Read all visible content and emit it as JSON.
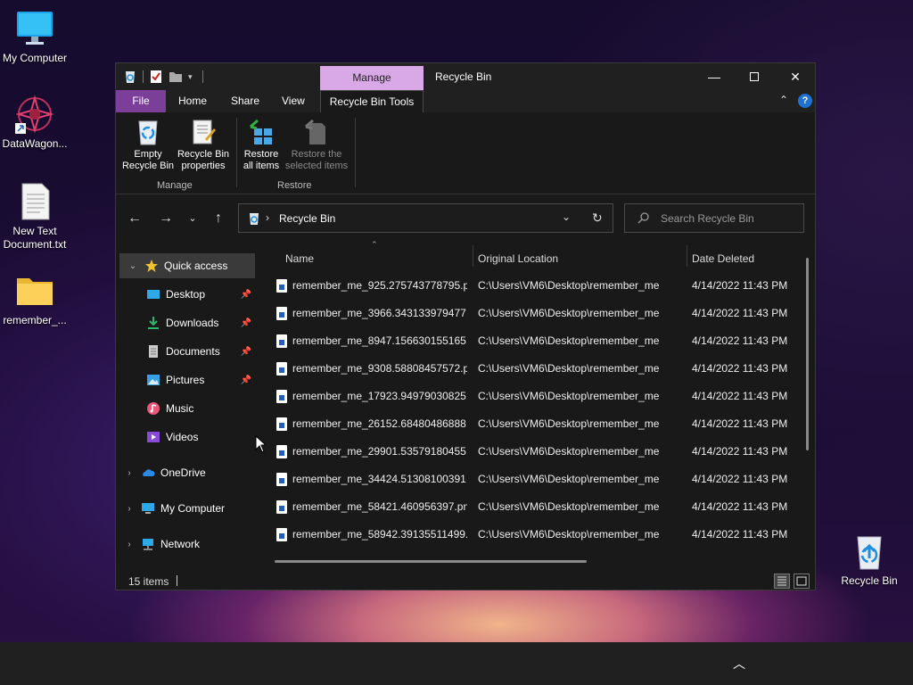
{
  "desktop": {
    "icons": [
      {
        "label": "My Computer"
      },
      {
        "label": "DataWagon..."
      },
      {
        "label": "New Text Document.txt"
      },
      {
        "label": "remember_..."
      },
      {
        "label": "Recycle Bin"
      }
    ]
  },
  "window": {
    "title": "Recycle Bin",
    "context_tab": "Manage",
    "tabs": [
      "File",
      "Home",
      "Share",
      "View",
      "Recycle Bin Tools"
    ],
    "ribbon": {
      "manage_group_label": "Manage",
      "restore_group_label": "Restore",
      "empty_bin": "Empty Recycle Bin",
      "properties": "Recycle Bin properties",
      "restore_all": "Restore all items",
      "restore_selected": "Restore the selected items"
    },
    "address": {
      "path": "Recycle Bin",
      "search_placeholder": "Search Recycle Bin"
    },
    "nav": {
      "quick_access": "Quick access",
      "desktop": "Desktop",
      "downloads": "Downloads",
      "documents": "Documents",
      "pictures": "Pictures",
      "music": "Music",
      "videos": "Videos",
      "onedrive": "OneDrive",
      "my_computer": "My Computer",
      "network": "Network"
    },
    "columns": {
      "name": "Name",
      "location": "Original Location",
      "date": "Date Deleted"
    },
    "files": [
      {
        "name": "remember_me_925.275743778795.p...",
        "location": "C:\\Users\\VM6\\Desktop\\remember_me",
        "date": "4/14/2022 11:43 PM"
      },
      {
        "name": "remember_me_3966.343133979477....",
        "location": "C:\\Users\\VM6\\Desktop\\remember_me",
        "date": "4/14/2022 11:43 PM"
      },
      {
        "name": "remember_me_8947.156630155165....",
        "location": "C:\\Users\\VM6\\Desktop\\remember_me",
        "date": "4/14/2022 11:43 PM"
      },
      {
        "name": "remember_me_9308.58808457572.p...",
        "location": "C:\\Users\\VM6\\Desktop\\remember_me",
        "date": "4/14/2022 11:43 PM"
      },
      {
        "name": "remember_me_17923.94979030825....",
        "location": "C:\\Users\\VM6\\Desktop\\remember_me",
        "date": "4/14/2022 11:43 PM"
      },
      {
        "name": "remember_me_26152.68480486888....",
        "location": "C:\\Users\\VM6\\Desktop\\remember_me",
        "date": "4/14/2022 11:43 PM"
      },
      {
        "name": "remember_me_29901.53579180455....",
        "location": "C:\\Users\\VM6\\Desktop\\remember_me",
        "date": "4/14/2022 11:43 PM"
      },
      {
        "name": "remember_me_34424.51308100391....",
        "location": "C:\\Users\\VM6\\Desktop\\remember_me",
        "date": "4/14/2022 11:43 PM"
      },
      {
        "name": "remember_me_58421.460956397.png",
        "location": "C:\\Users\\VM6\\Desktop\\remember_me",
        "date": "4/14/2022 11:43 PM"
      },
      {
        "name": "remember_me_58942.39135511499....",
        "location": "C:\\Users\\VM6\\Desktop\\remember_me",
        "date": "4/14/2022 11:43 PM"
      }
    ],
    "status": {
      "count": "15 items"
    }
  }
}
